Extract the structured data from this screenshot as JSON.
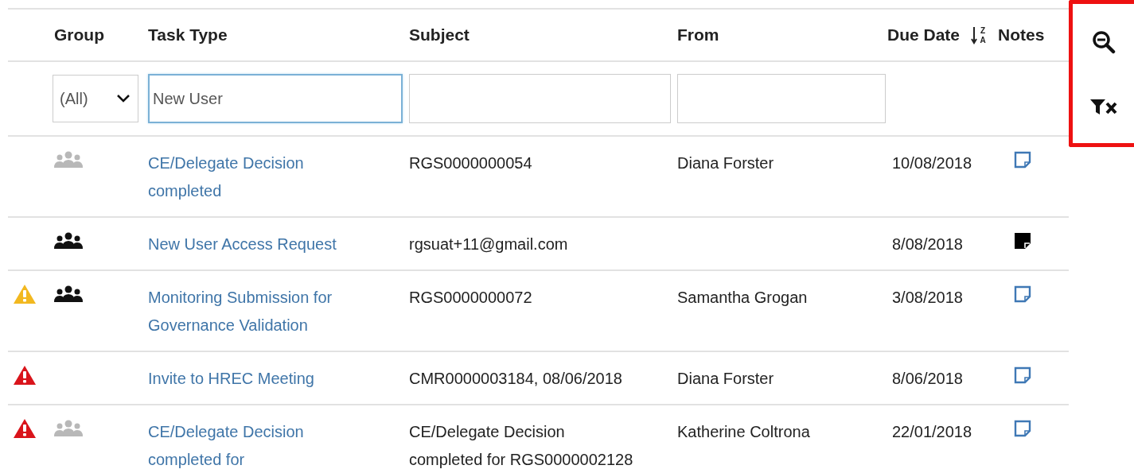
{
  "columns": [
    {
      "label": "Group"
    },
    {
      "label": "Task Type"
    },
    {
      "label": "Subject"
    },
    {
      "label": "From"
    },
    {
      "label": "Due Date"
    },
    {
      "label": "Notes"
    }
  ],
  "sort_icon": {
    "letters": [
      "Z",
      "A"
    ]
  },
  "filters": {
    "group": {
      "value": "(All)"
    },
    "task_type": {
      "value": "New User"
    }
  },
  "rows": [
    {
      "alert": false,
      "group_icon": true,
      "group_active": false,
      "task_type": "CE/Delegate Decision completed",
      "subject": "RGS0000000054",
      "from": "Diana Forster",
      "due_date": "10/08/2018",
      "has_notes": false
    },
    {
      "alert": false,
      "group_icon": true,
      "group_active": true,
      "task_type": "New User Access Request",
      "subject": "rgsuat+11@gmail.com",
      "due_date": "8/08/2018",
      "has_notes": true
    },
    {
      "alert": true,
      "alert_critical": false,
      "group_icon": true,
      "group_active": true,
      "task_type": "Monitoring Submission for Governance Validation",
      "subject": "RGS0000000072",
      "from": "Samantha Grogan",
      "due_date": "3/08/2018",
      "has_notes": false
    },
    {
      "alert": true,
      "alert_critical": true,
      "group_icon": false,
      "task_type": "Invite to HREC Meeting",
      "subject": "CMR0000003184, 08/06/2018",
      "from": "Diana Forster",
      "due_date": "8/06/2018",
      "has_notes": false
    },
    {
      "alert": true,
      "alert_critical": true,
      "group_icon": true,
      "group_active": false,
      "task_type": "CE/Delegate Decision completed for",
      "subject": "CE/Delegate Decision completed for RGS0000002128",
      "from": "Katherine Coltrona",
      "due_date": "22/01/2018",
      "has_notes": false
    }
  ]
}
